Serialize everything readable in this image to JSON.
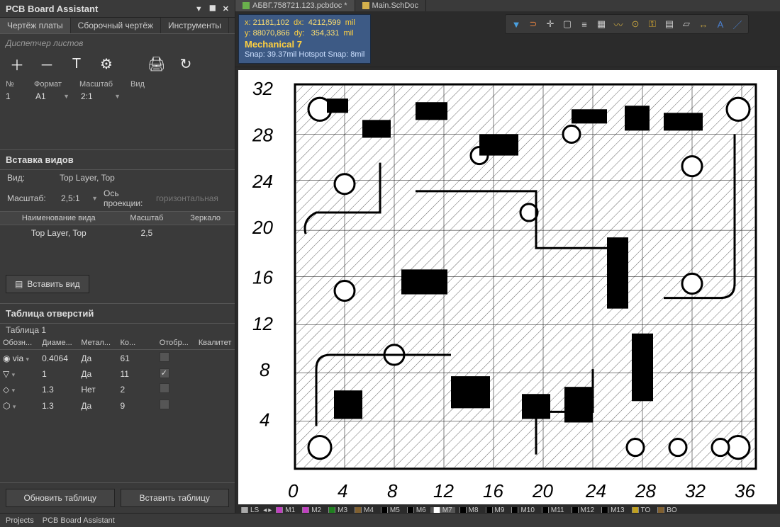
{
  "panel": {
    "title": "PCB Board Assistant",
    "tabs": [
      "Чертёж платы",
      "Сборочный чертёж",
      "Инструменты"
    ],
    "active_tab": 0,
    "sheets": {
      "header": "Диспетчер листов",
      "cols": [
        "№",
        "Формат",
        "Масштаб",
        "Вид"
      ],
      "row": {
        "num": "1",
        "format": "A1",
        "scale": "2:1",
        "view": ""
      }
    },
    "views": {
      "header": "Вставка видов",
      "view_label": "Вид:",
      "view_value": "Top Layer, Top",
      "scale_label": "Масштаб:",
      "scale_value": "2,5:1",
      "axis_label": "Ось проекции:",
      "axis_value": "горизонтальная",
      "grid_cols": [
        "Наименование вида",
        "Масштаб",
        "Зеркало"
      ],
      "grid_row": {
        "name": "Top Layer, Top",
        "scale": "2,5",
        "mirror": ""
      },
      "insert_btn": "Вставить вид"
    },
    "holes": {
      "header": "Таблица отверстий",
      "table_name": "Таблица 1",
      "cols": [
        "Обозн...",
        "Диаме...",
        "Метал...",
        "Ко...",
        "Отобр...",
        "Квалитет"
      ],
      "rows": [
        {
          "sym": "via",
          "dia": "0.4064",
          "metal": "Да",
          "count": "61",
          "show": false
        },
        {
          "sym": "tri",
          "dia": "1",
          "metal": "Да",
          "count": "11",
          "show": true
        },
        {
          "sym": "dia",
          "dia": "1.3",
          "metal": "Нет",
          "count": "2",
          "show": false
        },
        {
          "sym": "hex",
          "dia": "1.3",
          "metal": "Да",
          "count": "9",
          "show": false
        }
      ],
      "update_btn": "Обновить таблицу",
      "insert_btn": "Вставить таблицу"
    }
  },
  "editor": {
    "doc_tabs": [
      {
        "label": "АБВГ.758721.123.pcbdoc *",
        "active": true,
        "icon_color": "#6ab04c"
      },
      {
        "label": "Main.SchDoc",
        "active": false,
        "icon_color": "#d4b04c"
      }
    ],
    "coords": {
      "x_label": "x:",
      "x": "21181,102",
      "dx_label": "dx:",
      "dx": "4212,599",
      "unit": "mil",
      "y_label": "y:",
      "y": "88070,866",
      "dy_label": "dy:",
      "dy": "354,331",
      "layer": "Mechanical 7",
      "snap": "Snap: 39.37mil Hotspot Snap: 8mil"
    },
    "x_ticks": [
      "0",
      "4",
      "8",
      "12",
      "16",
      "20",
      "24",
      "28",
      "32",
      "36"
    ],
    "y_ticks": [
      "4",
      "8",
      "12",
      "16",
      "20",
      "24",
      "28",
      "32"
    ]
  },
  "layers": [
    {
      "n": "LS",
      "c": "#aaaaaa",
      "active": false
    },
    {
      "n": "M1",
      "c": "#c040c0"
    },
    {
      "n": "M2",
      "c": "#c040c0"
    },
    {
      "n": "M3",
      "c": "#208020"
    },
    {
      "n": "M4",
      "c": "#806030"
    },
    {
      "n": "M5",
      "c": "#000000"
    },
    {
      "n": "M6",
      "c": "#000000"
    },
    {
      "n": "M7",
      "c": "#ffffff",
      "active": true
    },
    {
      "n": "M8",
      "c": "#000000"
    },
    {
      "n": "M9",
      "c": "#000000"
    },
    {
      "n": "M10",
      "c": "#000000"
    },
    {
      "n": "M11",
      "c": "#000000"
    },
    {
      "n": "M12",
      "c": "#000000"
    },
    {
      "n": "M13",
      "c": "#000000"
    },
    {
      "n": "TO",
      "c": "#c0a020"
    },
    {
      "n": "BO",
      "c": "#806030"
    }
  ],
  "status": {
    "projects": "Projects",
    "assistant": "PCB Board Assistant"
  }
}
